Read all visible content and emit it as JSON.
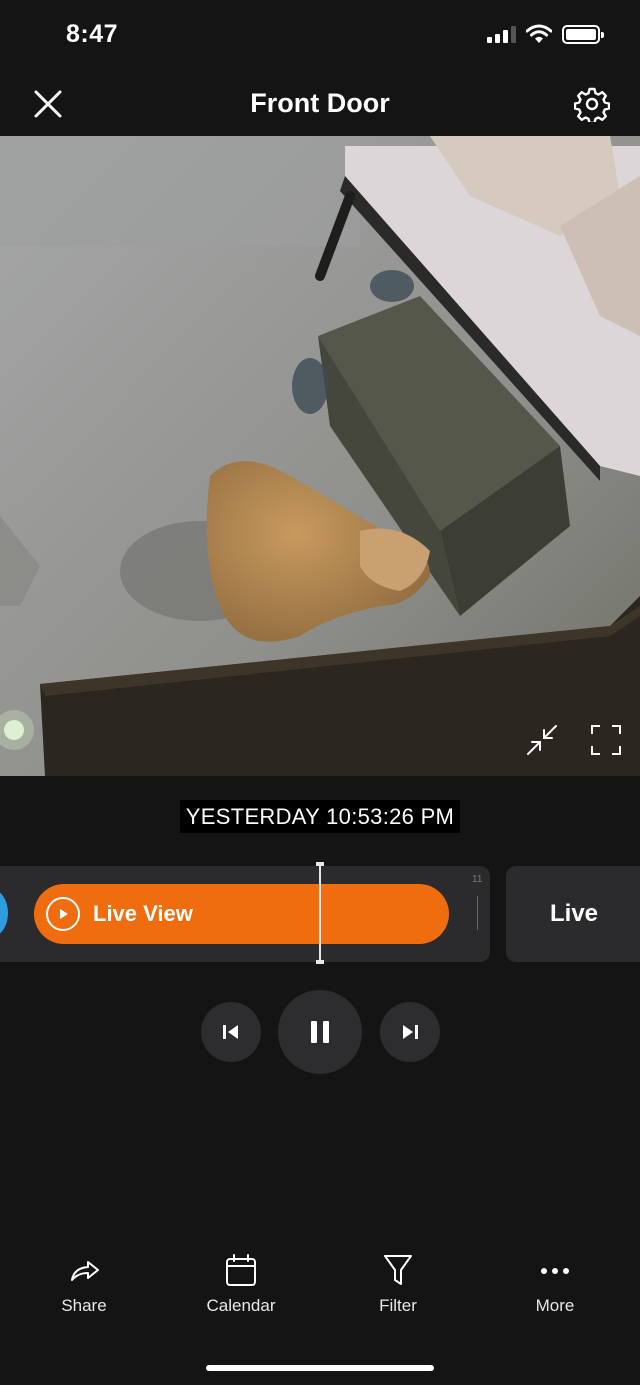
{
  "status_bar": {
    "time": "8:47",
    "icons": [
      "signal-icon",
      "wifi-icon",
      "battery-icon"
    ]
  },
  "header": {
    "title": "Front Door",
    "close_icon": "close-icon",
    "settings_icon": "gear-icon"
  },
  "video": {
    "controls": [
      "collapse-icon",
      "fullscreen-icon"
    ]
  },
  "timestamp": "YESTERDAY 10:53:26 PM",
  "timeline": {
    "event_label": "Live View",
    "tick_label": "11",
    "live_label": "Live"
  },
  "playback": {
    "buttons": [
      "skip-previous-icon",
      "pause-icon",
      "skip-next-icon"
    ]
  },
  "bottom_nav": {
    "items": [
      {
        "label": "Share",
        "icon": "share-icon"
      },
      {
        "label": "Calendar",
        "icon": "calendar-icon"
      },
      {
        "label": "Filter",
        "icon": "filter-icon"
      },
      {
        "label": "More",
        "icon": "more-icon"
      }
    ]
  },
  "colors": {
    "background": "#141414",
    "accent": "#f06d0f",
    "timeline_track": "#2b2b2d",
    "edge_event": "#2b9de0"
  }
}
